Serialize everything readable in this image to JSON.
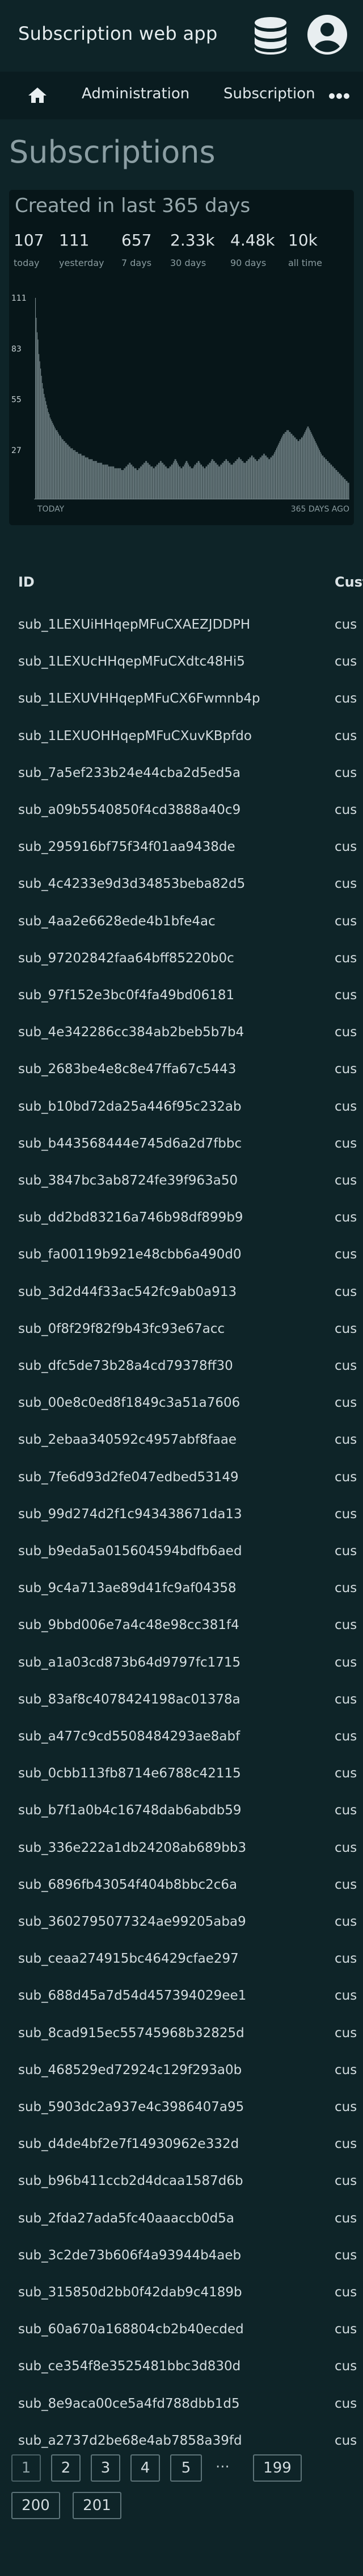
{
  "app": {
    "title": "Subscription web app"
  },
  "header": {
    "db_icon": "database-icon",
    "user_icon": "user-account-icon"
  },
  "nav": {
    "home_icon": "home-icon",
    "items": [
      {
        "label": "Administration"
      },
      {
        "label": "Subscription admin"
      }
    ],
    "more_icon": "more-horizontal-icon"
  },
  "page": {
    "title": "Subscriptions"
  },
  "stats": {
    "title": "Created in last 365 days",
    "items": [
      {
        "value": "107",
        "label": "today"
      },
      {
        "value": "111",
        "label": "yesterday"
      },
      {
        "value": "657",
        "label": "7 days"
      },
      {
        "value": "2.33k",
        "label": "30 days"
      },
      {
        "value": "4.48k",
        "label": "90 days"
      },
      {
        "value": "10k",
        "label": "all time"
      }
    ]
  },
  "chart_data": {
    "type": "bar",
    "title": "",
    "xlabel": "",
    "ylabel": "",
    "x_left_label": "TODAY",
    "x_right_label": "365 DAYS AGO",
    "y_ticks": [
      27,
      55,
      83,
      111
    ],
    "ylim": [
      0,
      111
    ],
    "grid": false,
    "color": "#7d8e92",
    "values": [
      111,
      100,
      92,
      88,
      80,
      76,
      72,
      68,
      64,
      61,
      58,
      56,
      54,
      52,
      50,
      48,
      47,
      45,
      44,
      43,
      42,
      41,
      40,
      39,
      38,
      38,
      37,
      36,
      35,
      35,
      34,
      33,
      33,
      32,
      32,
      31,
      31,
      30,
      30,
      29,
      29,
      28,
      28,
      28,
      27,
      27,
      27,
      26,
      26,
      26,
      25,
      25,
      25,
      25,
      24,
      24,
      24,
      24,
      23,
      23,
      23,
      23,
      22,
      22,
      22,
      22,
      22,
      21,
      21,
      21,
      21,
      21,
      20,
      20,
      20,
      20,
      20,
      20,
      19,
      19,
      19,
      19,
      19,
      19,
      19,
      18,
      18,
      18,
      18,
      18,
      18,
      18,
      17,
      17,
      17,
      17,
      17,
      17,
      17,
      17,
      16,
      16,
      16,
      17,
      17,
      18,
      18,
      19,
      19,
      20,
      20,
      19,
      19,
      18,
      18,
      17,
      17,
      17,
      16,
      16,
      17,
      17,
      18,
      18,
      19,
      19,
      20,
      20,
      21,
      21,
      20,
      20,
      19,
      19,
      18,
      18,
      18,
      17,
      17,
      18,
      18,
      19,
      19,
      20,
      20,
      21,
      21,
      20,
      20,
      19,
      19,
      18,
      18,
      17,
      17,
      17,
      18,
      18,
      19,
      19,
      20,
      21,
      22,
      22,
      21,
      20,
      19,
      18,
      18,
      17,
      17,
      18,
      18,
      19,
      20,
      21,
      21,
      20,
      19,
      18,
      18,
      17,
      17,
      17,
      18,
      19,
      19,
      20,
      20,
      21,
      21,
      20,
      19,
      19,
      18,
      18,
      17,
      17,
      18,
      18,
      19,
      19,
      20,
      20,
      21,
      22,
      22,
      21,
      21,
      20,
      20,
      19,
      19,
      18,
      18,
      19,
      19,
      20,
      20,
      21,
      21,
      22,
      22,
      21,
      21,
      20,
      20,
      19,
      19,
      19,
      20,
      20,
      21,
      21,
      22,
      22,
      23,
      23,
      22,
      22,
      21,
      21,
      20,
      20,
      20,
      21,
      21,
      22,
      22,
      23,
      23,
      24,
      24,
      23,
      23,
      22,
      22,
      21,
      21,
      22,
      22,
      23,
      23,
      24,
      24,
      25,
      25,
      24,
      24,
      23,
      23,
      22,
      22,
      23,
      23,
      24,
      24,
      25,
      26,
      27,
      28,
      29,
      30,
      31,
      32,
      33,
      34,
      35,
      36,
      36,
      37,
      37,
      38,
      38,
      38,
      37,
      37,
      36,
      36,
      35,
      35,
      34,
      34,
      33,
      33,
      32,
      32,
      33,
      33,
      34,
      34,
      35,
      36,
      37,
      38,
      39,
      40,
      40,
      39,
      38,
      37,
      36,
      35,
      34,
      33,
      32,
      31,
      30,
      29,
      28,
      27,
      26,
      25,
      24,
      24,
      23,
      23,
      22,
      22,
      21,
      21,
      20,
      20,
      19,
      19,
      18,
      18,
      17,
      17,
      16,
      16,
      15,
      15,
      14,
      14,
      13,
      13,
      12,
      12,
      11,
      11,
      10,
      10,
      9,
      9
    ]
  },
  "table": {
    "columns": [
      "ID",
      "Customer"
    ],
    "rows": [
      {
        "id": "sub_1LEXUiHHqepMFuCXAEZJDDPH",
        "customer": "cus"
      },
      {
        "id": "sub_1LEXUcHHqepMFuCXdtc48Hi5",
        "customer": "cus"
      },
      {
        "id": "sub_1LEXUVHHqepMFuCX6Fwmnb4p",
        "customer": "cus"
      },
      {
        "id": "sub_1LEXUOHHqepMFuCXuvKBpfdo",
        "customer": "cus"
      },
      {
        "id": "sub_7a5ef233b24e44cba2d5ed5a",
        "customer": "cus"
      },
      {
        "id": "sub_a09b5540850f4cd3888a40c9",
        "customer": "cus"
      },
      {
        "id": "sub_295916bf75f34f01aa9438de",
        "customer": "cus"
      },
      {
        "id": "sub_4c4233e9d3d34853beba82d5",
        "customer": "cus"
      },
      {
        "id": "sub_4aa2e6628ede4b1bfe4ac",
        "customer": "cus"
      },
      {
        "id": "sub_97202842faa64bff85220b0c",
        "customer": "cus"
      },
      {
        "id": "sub_97f152e3bc0f4fa49bd06181",
        "customer": "cus"
      },
      {
        "id": "sub_4e342286cc384ab2beb5b7b4",
        "customer": "cus"
      },
      {
        "id": "sub_2683be4e8c8e47ffa67c5443",
        "customer": "cus"
      },
      {
        "id": "sub_b10bd72da25a446f95c232ab",
        "customer": "cus"
      },
      {
        "id": "sub_b443568444e745d6a2d7fbbc",
        "customer": "cus"
      },
      {
        "id": "sub_3847bc3ab8724fe39f963a50",
        "customer": "cus"
      },
      {
        "id": "sub_dd2bd83216a746b98df899b9",
        "customer": "cus"
      },
      {
        "id": "sub_fa00119b921e48cbb6a490d0",
        "customer": "cus"
      },
      {
        "id": "sub_3d2d44f33ac542fc9ab0a913",
        "customer": "cus"
      },
      {
        "id": "sub_0f8f29f82f9b43fc93e67acc",
        "customer": "cus"
      },
      {
        "id": "sub_dfc5de73b28a4cd79378ff30",
        "customer": "cus"
      },
      {
        "id": "sub_00e8c0ed8f1849c3a51a7606",
        "customer": "cus"
      },
      {
        "id": "sub_2ebaa340592c4957abf8faae",
        "customer": "cus"
      },
      {
        "id": "sub_7fe6d93d2fe047edbed53149",
        "customer": "cus"
      },
      {
        "id": "sub_99d274d2f1c943438671da13",
        "customer": "cus"
      },
      {
        "id": "sub_b9eda5a015604594bdfb6aed",
        "customer": "cus"
      },
      {
        "id": "sub_9c4a713ae89d41fc9af04358",
        "customer": "cus"
      },
      {
        "id": "sub_9bbd006e7a4c48e98cc381f4",
        "customer": "cus"
      },
      {
        "id": "sub_a1a03cd873b64d9797fc1715",
        "customer": "cus"
      },
      {
        "id": "sub_83af8c4078424198ac01378a",
        "customer": "cus"
      },
      {
        "id": "sub_a477c9cd5508484293ae8abf",
        "customer": "cus"
      },
      {
        "id": "sub_0cbb113fb8714e6788c42115",
        "customer": "cus"
      },
      {
        "id": "sub_b7f1a0b4c16748dab6abdb59",
        "customer": "cus"
      },
      {
        "id": "sub_336e222a1db24208ab689bb3",
        "customer": "cus"
      },
      {
        "id": "sub_6896fb43054f404b8bbc2c6a",
        "customer": "cus"
      },
      {
        "id": "sub_3602795077324ae99205aba9",
        "customer": "cus"
      },
      {
        "id": "sub_ceaa274915bc46429cfae297",
        "customer": "cus"
      },
      {
        "id": "sub_688d45a7d54d457394029ee1",
        "customer": "cus"
      },
      {
        "id": "sub_8cad915ec55745968b32825d",
        "customer": "cus"
      },
      {
        "id": "sub_468529ed72924c129f293a0b",
        "customer": "cus"
      },
      {
        "id": "sub_5903dc2a937e4c3986407a95",
        "customer": "cus"
      },
      {
        "id": "sub_d4de4bf2e7f14930962e332d",
        "customer": "cus"
      },
      {
        "id": "sub_b96b411ccb2d4dcaa1587d6b",
        "customer": "cus"
      },
      {
        "id": "sub_2fda27ada5fc40aaaccb0d5a",
        "customer": "cus"
      },
      {
        "id": "sub_3c2de73b606f4a93944b4aeb",
        "customer": "cus"
      },
      {
        "id": "sub_315850d2bb0f42dab9c4189b",
        "customer": "cus"
      },
      {
        "id": "sub_60a670a168804cb2b40ecded",
        "customer": "cus"
      },
      {
        "id": "sub_ce354f8e3525481bbc3d830d",
        "customer": "cus"
      },
      {
        "id": "sub_8e9aca00ce5a4fd788dbb1d5",
        "customer": "cus"
      },
      {
        "id": "sub_a2737d2be68e4ab7858a39fd",
        "customer": "cus"
      }
    ]
  },
  "pagination": {
    "pages": [
      "1",
      "2",
      "3",
      "4",
      "5",
      "199",
      "200",
      "201"
    ],
    "current": "1",
    "ellipsis": "..."
  }
}
